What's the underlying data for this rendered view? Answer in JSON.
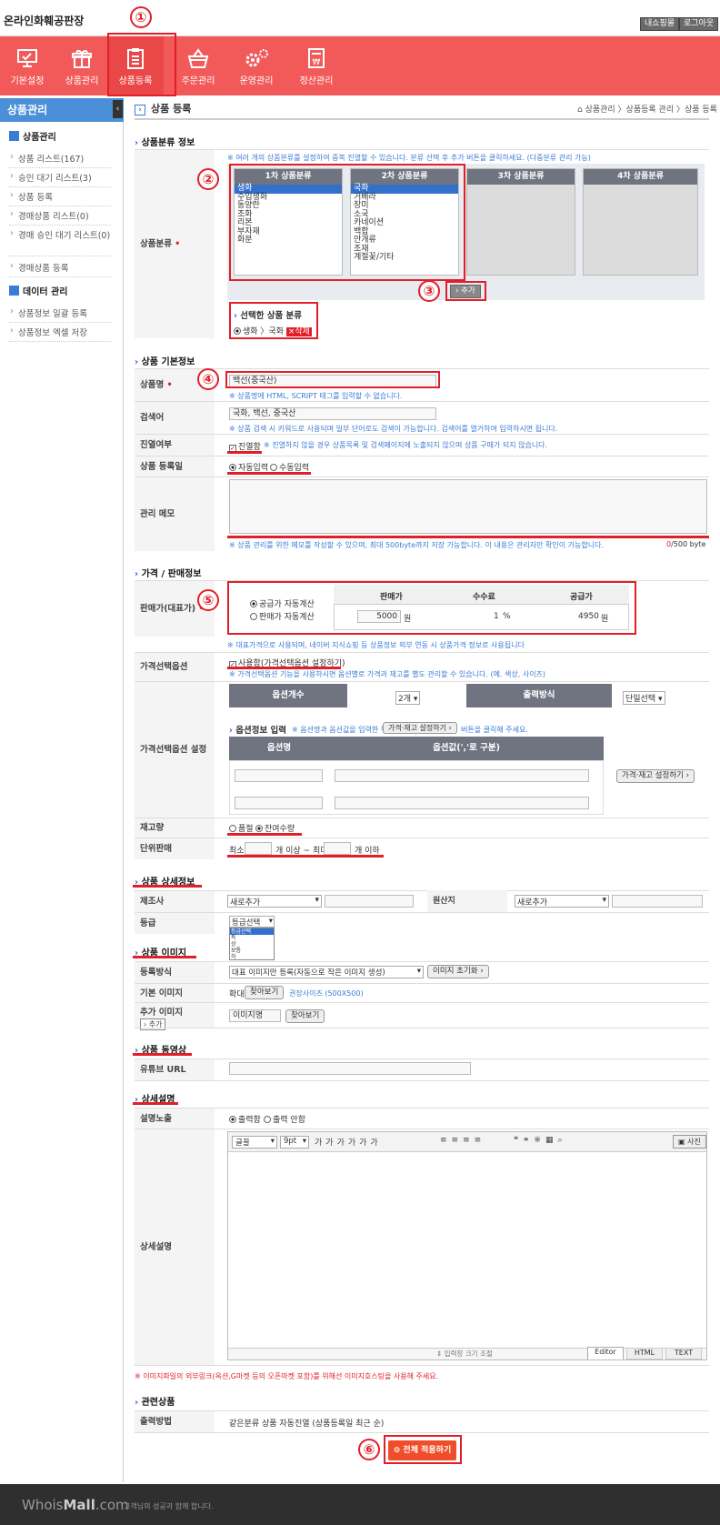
{
  "header": {
    "logo": "온라인화훼공판장",
    "btn_myshop": "내쇼핑몰",
    "btn_logout": "로그아웃"
  },
  "menu": [
    {
      "label": "기본설정",
      "icon": "monitor-icon"
    },
    {
      "label": "상품관리",
      "icon": "gift-icon"
    },
    {
      "label": "상품등록",
      "icon": "clipboard-icon"
    },
    {
      "label": "주문관리",
      "icon": "basket-icon"
    },
    {
      "label": "운영관리",
      "icon": "gear-icon"
    },
    {
      "label": "정산관리",
      "icon": "won-document-icon"
    }
  ],
  "sidebar": {
    "title": "상품관리",
    "group1": "상품관리",
    "items1": [
      "상품 리스트(167)",
      "승인 대기 리스트(3)",
      "상품 등록",
      "경매상품 리스트(0)",
      "경매 승인 대기 리스트(0)",
      "경매상품 등록"
    ],
    "group2": "데이터 관리",
    "items2": [
      "상품정보 일괄 등록",
      "상품정보 엑셀 저장"
    ]
  },
  "page": {
    "title": "상품 등록",
    "breadcrumb": "상품관리 〉상품등록 관리 〉상품 등록"
  },
  "category": {
    "section": "상품분류 정보",
    "label": "상품분류",
    "note": "※ 여러 개의 상품분류를 설정하여 중복 진열할 수 있습니다. 분류 선택 후 추가 버튼을 클릭하세요. (다중분류 관리 가능)",
    "col_headers": [
      "1차 상품분류",
      "2차 상품분류",
      "3차 상품분류",
      "4차 상품분류"
    ],
    "col1": [
      "생화",
      "수입생화",
      "동양란",
      "조화",
      "리본",
      "부자재",
      "화분"
    ],
    "col2": [
      "국화",
      "거베라",
      "장미",
      "소국",
      "카네이션",
      "백합",
      "안개류",
      "조재",
      "계절꽃/기타"
    ],
    "add_btn": "› 추가",
    "selected_title": "선택한 상품 분류",
    "selected_value": "생화 〉국화",
    "delete_btn": "×삭제"
  },
  "basic": {
    "section": "상품 기본정보",
    "name_label": "상품명",
    "name_value": "백선(중국산)",
    "name_note": "※ 상품명에 HTML, SCRIPT 태그를 입력할 수 없습니다.",
    "search_label": "검색어",
    "search_value": "국화, 백선, 중국산",
    "search_note": "※ 상품 검색 시 키워드로 사용되며 일부 단어로도 검색이 가능합니다. 검색어를 열거하여 입력하시면 됩니다.",
    "display_label": "진열여부",
    "display_value": "진열함",
    "display_note": "※ 진열하지 않을 경우 상품목록 및 검색페이지에 노출되지 않으며 상품 구매가 되지 않습니다.",
    "reg_label": "상품 등록일",
    "reg_auto": "자동입력",
    "reg_manual": "수동입력",
    "memo_label": "관리 메모",
    "memo_note": "※ 상품 관리를 위한 메모를 작성할 수 있으며, 최대 500byte까지 저장 가능합니다. 이 내용은 관리자만 확인이 가능합니다.",
    "memo_count": "0",
    "memo_max": "/500 byte"
  },
  "price": {
    "section": "가격 / 판매정보",
    "label": "판매가(대표가)",
    "calc1": "공급가 자동계산",
    "calc2": "판매가 자동계산",
    "col_sale": "판매가",
    "col_fee": "수수료",
    "col_supply": "공급가",
    "sale_value": "5000",
    "sale_unit": "원",
    "fee_value": "1",
    "fee_unit": "%",
    "supply_value": "4950",
    "supply_unit": "원",
    "note": "※ 대표가격으로 사용되며, 네이버 지식쇼핑 등 상품정보 외부 연동 시 상품가격 정보로 사용됩니다",
    "opt_label": "가격선택옵션",
    "opt_value": "사용함(가격선택옵션 설정하기)",
    "opt_note": "※ 가격선택옵션 기능을 사용하시면 옵션별로 가격과 재고를 별도 관리할 수 있습니다. (예. 색상, 사이즈)",
    "optset_label": "가격선택옵션 설정",
    "optcount_h": "옵션개수",
    "optcount_v": "2개",
    "output_h": "출력방식",
    "output_v": "단일선택",
    "optinfo_title": "옵션정보 입력",
    "optinfo_note": "※ 옵션명과 옵션값을 입력한 뒤",
    "optinfo_btn": "가격·재고 설정하기 ›",
    "optinfo_note2": "버튼을 클릭해 주세요.",
    "optname_h": "옵션명",
    "optval_h": "옵션값(','로 구분)",
    "optset_btn": "가격·재고 설정하기 ›",
    "stock_label": "재고량",
    "stock_soldout": "품절",
    "stock_remain": "잔여수량",
    "unit_label": "단위판매",
    "unit_min": "최소",
    "unit_mid": "개 이상 ~ 최대",
    "unit_max": "개 이하"
  },
  "detail": {
    "section": "상품 상세정보",
    "maker_label": "제조사",
    "maker_value": "새로추가",
    "origin_label": "원산지",
    "origin_value": "새로추가",
    "grade_label": "등급",
    "grade_value": "등급선택",
    "grade_options": [
      "등급선택",
      "특",
      "상",
      "보통",
      "하"
    ]
  },
  "image": {
    "section": "상품 이미지",
    "method_label": "등록방식",
    "method_value": "대표 이미지만 등록(자동으로 작은 이미지 생성)",
    "reset_btn": "이미지 초기화 ›",
    "basic_label": "기본 이미지",
    "zoom": "확대",
    "browse": "찾아보기",
    "size_note": "권장사이즈 (500X500)",
    "extra_label": "추가 이미지",
    "extra_add": "› 추가",
    "extra_name": "이미지명",
    "browse2": "찾아보기"
  },
  "video": {
    "section": "상품 동영상",
    "url_label": "유튜브 URL"
  },
  "desc": {
    "section": "상세설명",
    "expose_label": "설명노출",
    "expose_yes": "출력함",
    "expose_no": "출력 안함",
    "editor_label": "상세설명",
    "font": "글꼴",
    "size": "9pt",
    "photo_btn": "사진",
    "resize": "입력창 크기 조절",
    "tab_editor": "Editor",
    "tab_html": "HTML",
    "tab_text": "TEXT",
    "warn": "※ 이미지파일의 외부링크(옥션,G마켓 등의 오픈마켓 포함)를 위해선 이미지호스팅을 사용해 주세요."
  },
  "related": {
    "section": "관련상품",
    "label": "출력방법",
    "value": "같은분류 상품 자동진열 (상품등록일 최근 순)"
  },
  "submit": "⊙ 전체 적용하기",
  "footer": {
    "brand1": "Whois",
    "brand2": "Mall",
    "brand3": ".com",
    "slogan": "고객님의 성공과 함께 합니다."
  },
  "markers": [
    "①",
    "②",
    "③",
    "④",
    "⑤",
    "⑥"
  ],
  "colors": {
    "menu": "#f25a5a",
    "accent": "#e21f28",
    "sidebar": "#4b8fd8",
    "table_head": "#6f7480"
  }
}
